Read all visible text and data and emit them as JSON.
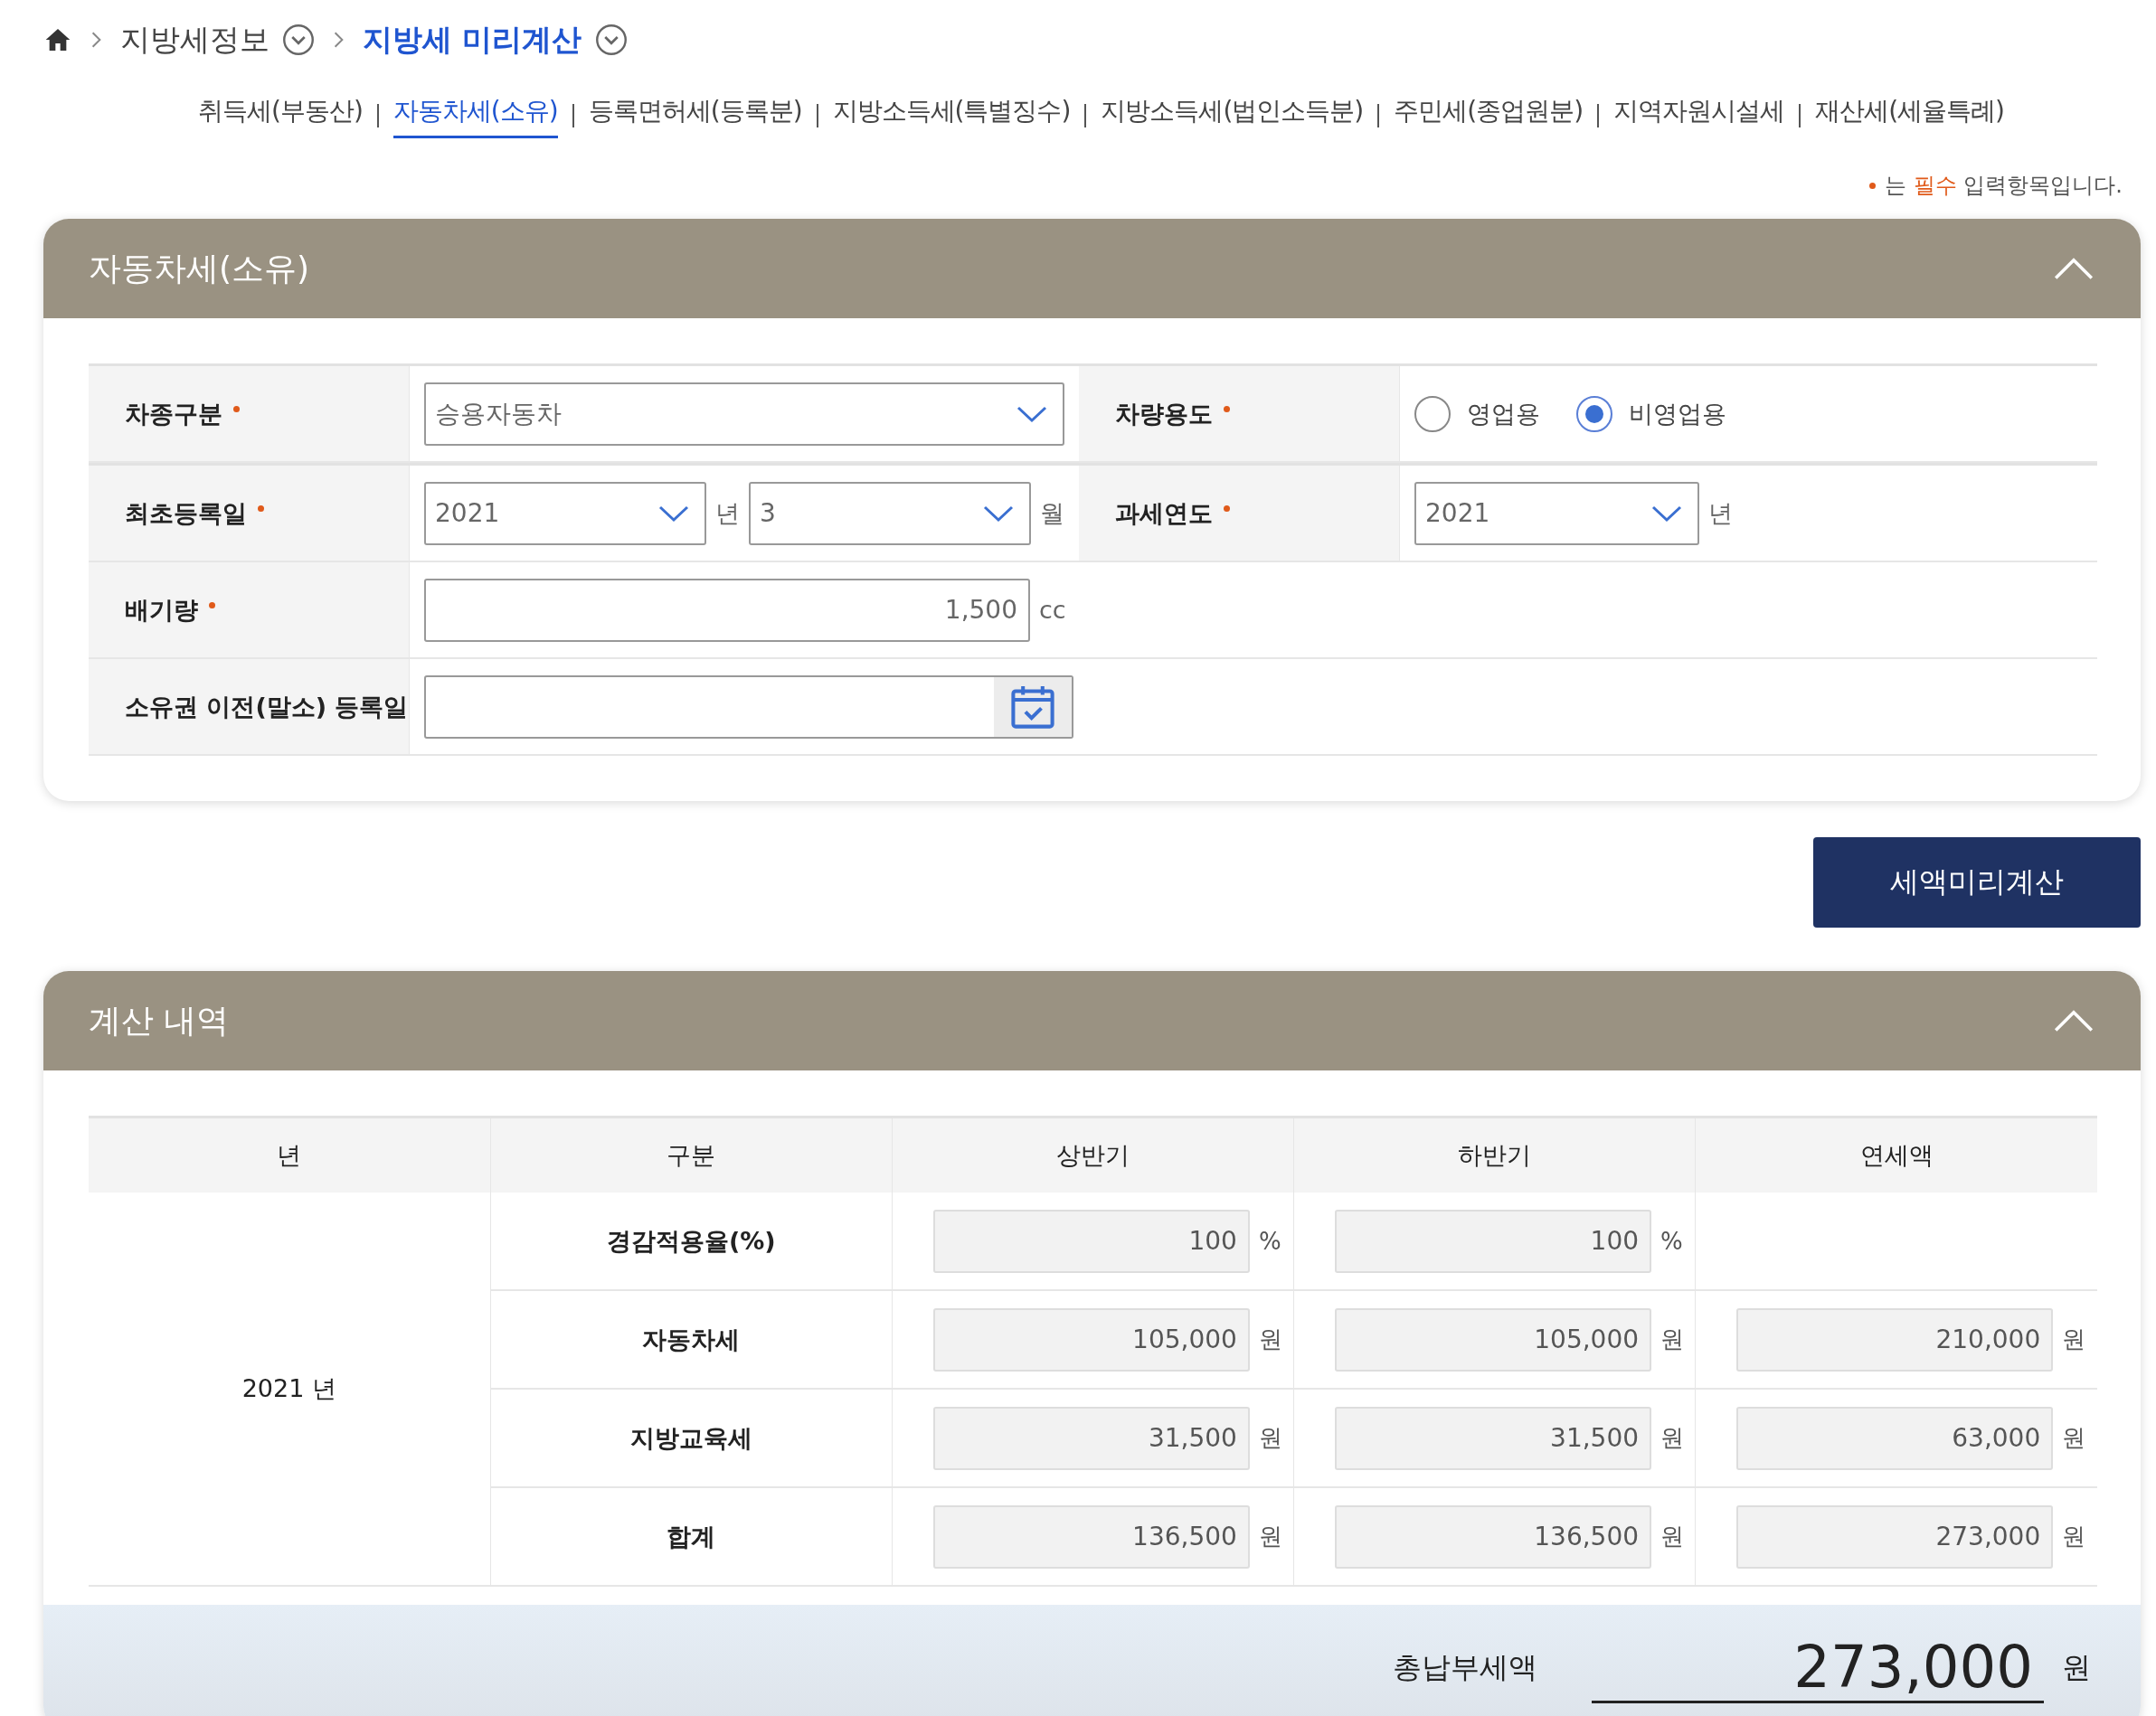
{
  "breadcrumb": [
    {
      "label": "지방세정보",
      "current": false
    },
    {
      "label": "지방세 미리계산",
      "current": true
    }
  ],
  "tabs": [
    {
      "label": "취득세(부동산)",
      "selected": false
    },
    {
      "label": "자동차세(소유)",
      "selected": true
    },
    {
      "label": "등록면허세(등록분)",
      "selected": false
    },
    {
      "label": "지방소득세(특별징수)",
      "selected": false
    },
    {
      "label": "지방소득세(법인소득분)",
      "selected": false
    },
    {
      "label": "주민세(종업원분)",
      "selected": false
    },
    {
      "label": "지역자원시설세",
      "selected": false
    },
    {
      "label": "재산세(세율특례)",
      "selected": false
    }
  ],
  "required_note": {
    "prefix": "는",
    "emphasis": "필수",
    "suffix": "입력항목입니다."
  },
  "input_panel": {
    "title": "자동차세(소유)",
    "expanded": true,
    "rows": [
      {
        "fields": [
          {
            "label": "차종구분",
            "required": true,
            "controls": [
              {
                "kind": "select",
                "value": "승용자동차"
              }
            ]
          },
          {
            "label": "차량용도",
            "required": true,
            "controls": [
              {
                "kind": "radio",
                "options": [
                  {
                    "label": "영업용",
                    "selected": false
                  },
                  {
                    "label": "비영업용",
                    "selected": true
                  }
                ]
              }
            ]
          }
        ]
      },
      {
        "fields": [
          {
            "label": "최초등록일",
            "required": true,
            "controls": [
              {
                "kind": "select",
                "value": "2021",
                "unit": "년"
              },
              {
                "kind": "select",
                "value": "3",
                "unit": "월"
              }
            ]
          },
          {
            "label": "과세연도",
            "required": true,
            "controls": [
              {
                "kind": "select",
                "value": "2021",
                "unit": "년"
              }
            ]
          }
        ]
      },
      {
        "fields": [
          {
            "label": "배기량",
            "required": true,
            "controls": [
              {
                "kind": "number",
                "value": "1,500",
                "unit": "cc"
              }
            ]
          }
        ]
      },
      {
        "fields": [
          {
            "label": "소유권 이전(말소) 등록일",
            "required": false,
            "controls": [
              {
                "kind": "date"
              }
            ]
          }
        ]
      }
    ]
  },
  "calculate_button": "세액미리계산",
  "result_panel": {
    "title": "계산 내역",
    "expanded": true,
    "columns": [
      "년",
      "구분",
      "상반기",
      "하반기",
      "연세액"
    ],
    "rows": [
      {
        "cells": [
          {
            "kind": "year",
            "text": "2021 년",
            "rowspan": 4
          },
          {
            "kind": "label",
            "text": "경감적용율(%)"
          },
          {
            "kind": "amount",
            "value": "100",
            "unit": "%"
          },
          {
            "kind": "amount",
            "value": "100",
            "unit": "%"
          },
          {
            "kind": "blank"
          }
        ]
      },
      {
        "cells": [
          {
            "kind": "label",
            "text": "자동차세"
          },
          {
            "kind": "amount",
            "value": "105,000",
            "unit": "원"
          },
          {
            "kind": "amount",
            "value": "105,000",
            "unit": "원"
          },
          {
            "kind": "amount",
            "value": "210,000",
            "unit": "원"
          }
        ]
      },
      {
        "cells": [
          {
            "kind": "label",
            "text": "지방교육세"
          },
          {
            "kind": "amount",
            "value": "31,500",
            "unit": "원"
          },
          {
            "kind": "amount",
            "value": "31,500",
            "unit": "원"
          },
          {
            "kind": "amount",
            "value": "63,000",
            "unit": "원"
          }
        ]
      },
      {
        "cells": [
          {
            "kind": "label",
            "text": "합계"
          },
          {
            "kind": "amount",
            "value": "136,500",
            "unit": "원"
          },
          {
            "kind": "amount",
            "value": "136,500",
            "unit": "원"
          },
          {
            "kind": "amount",
            "value": "273,000",
            "unit": "원"
          }
        ]
      }
    ],
    "total": {
      "label": "총납부세액",
      "value": "273,000",
      "unit": "원"
    }
  }
}
